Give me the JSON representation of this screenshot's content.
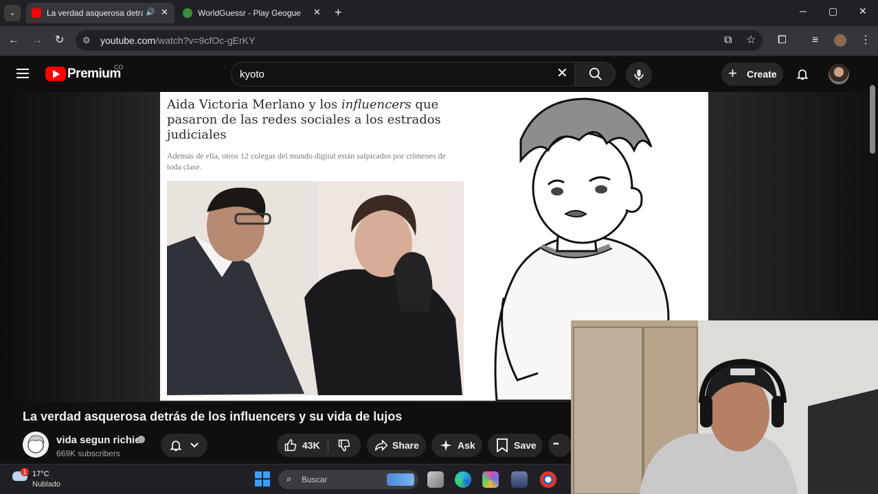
{
  "browser": {
    "tab_menu_glyph": "⌄",
    "tabs": [
      {
        "title": "La verdad asquerosa detrás",
        "active": true,
        "audio_glyph": "🔊",
        "favicon_color": "#ff0000"
      },
      {
        "title": "WorldGuessr - Play Geoguessr",
        "active": false,
        "favicon_color": "#3a8e3a"
      }
    ],
    "close_glyph": "✕",
    "newtab_glyph": "+",
    "window": {
      "minimize": "─",
      "maximize": "▢",
      "close": "✕"
    },
    "nav": {
      "back": "←",
      "forward": "→",
      "reload": "↻"
    },
    "url_host": "youtube.com",
    "url_rest": "/watch?v=9cfOc-gErKY",
    "site_info_glyph": "⚙",
    "toolbar_icons": {
      "install": "⧉",
      "bookmark": "☆",
      "extensions": "⧠",
      "media": "≡",
      "menu": "⋮"
    }
  },
  "youtube": {
    "logo_text": "Premium",
    "country_code": "CO",
    "search_value": "kyoto",
    "search_clear": "✕",
    "create_label": "Create",
    "create_plus": "+"
  },
  "article": {
    "headline_part1": "Aida Victoria Merlano y los ",
    "headline_em": "influencers",
    "headline_part2": " que pasaron de las redes sociales a los estrados judiciales",
    "subhead": "Además de ella, otros 12 colegas del mundo digital están salpicados por crímenes de toda clase."
  },
  "video": {
    "title": "La verdad asquerosa detrás de los influencers y su vida de lujos",
    "channel_name": "vida segun richie",
    "subscribers": "669K subscribers",
    "like_count": "43K",
    "share_label": "Share",
    "ask_label": "Ask",
    "save_label": "Save",
    "more_glyph": "•••"
  },
  "taskbar": {
    "weather_badge": "1",
    "temperature": "17°C",
    "condition": "Nublado",
    "search_placeholder": "Buscar",
    "search_glyph": "⌕"
  },
  "colors": {
    "accent_red": "#ff0000",
    "bg": "#0f0f0f",
    "pill": "#272727"
  }
}
